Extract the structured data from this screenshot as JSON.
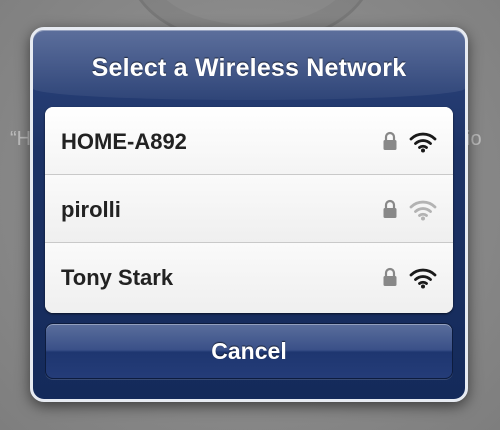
{
  "background": {
    "left_fragment": "“H",
    "right_fragment": "io"
  },
  "alert": {
    "title": "Select a Wireless Network",
    "cancel_label": "Cancel"
  },
  "networks": [
    {
      "name": "HOME-A892",
      "secured": true,
      "signal_bars": 3,
      "icons": [
        "lock-icon",
        "wifi-icon"
      ]
    },
    {
      "name": "pirolli",
      "secured": true,
      "signal_bars": 2,
      "icons": [
        "lock-icon",
        "wifi-icon"
      ]
    },
    {
      "name": "Tony Stark",
      "secured": true,
      "signal_bars": 3,
      "icons": [
        "lock-icon",
        "wifi-icon"
      ]
    }
  ],
  "colors": {
    "alert_blue": "#1d3366",
    "icon_active": "#1a1a1a",
    "icon_inactive": "#b3b3b3",
    "lock_gray": "#888888"
  }
}
